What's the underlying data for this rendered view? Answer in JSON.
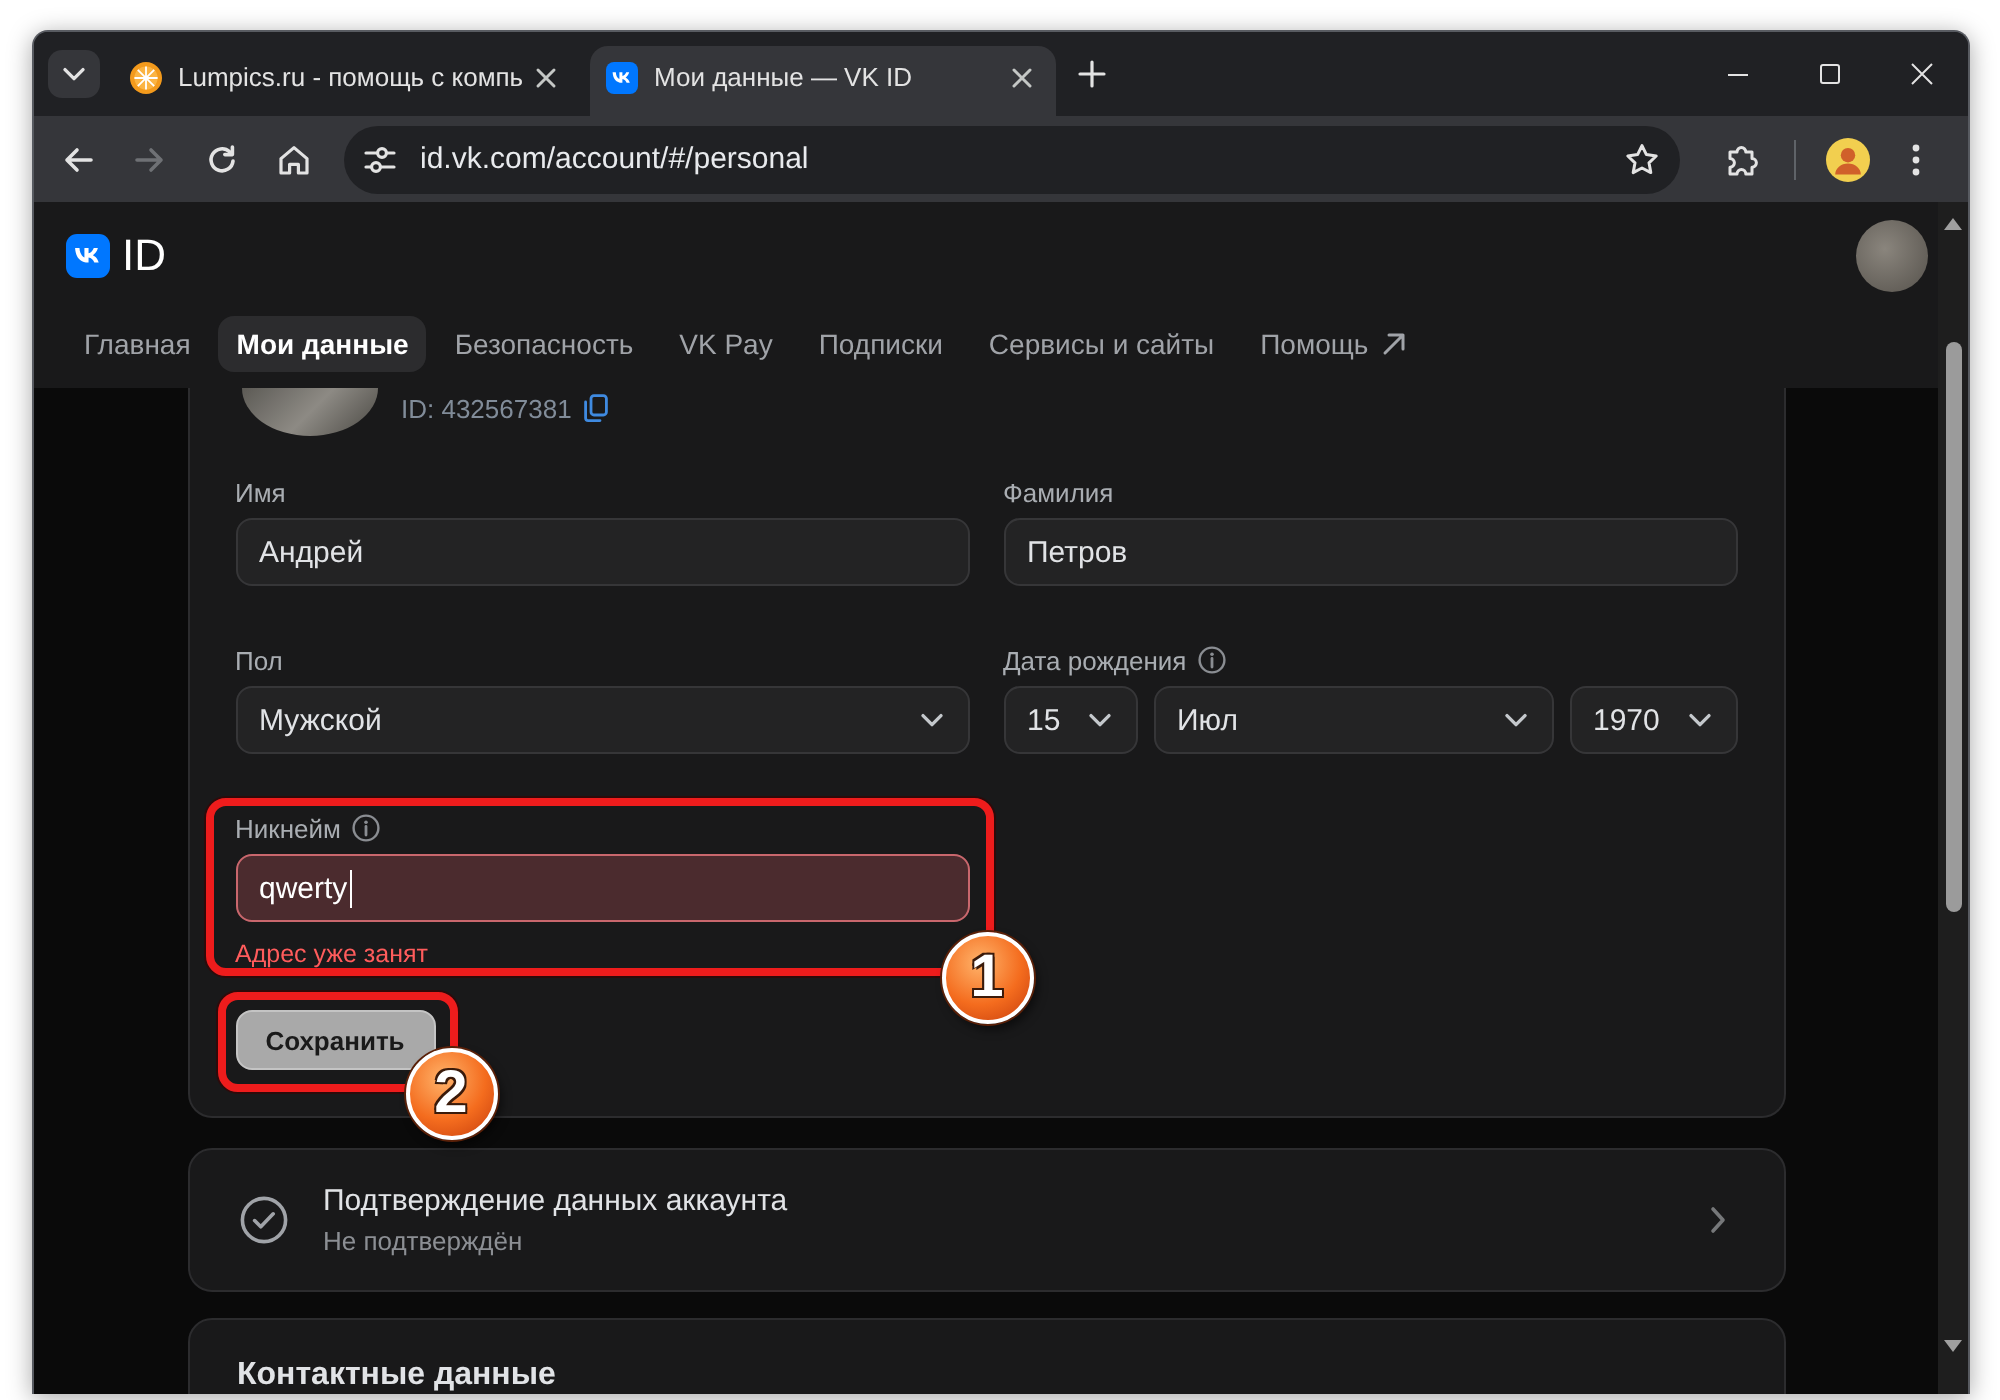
{
  "browser": {
    "tabs": [
      {
        "title": "Lumpics.ru - помощь с компь",
        "selected": false
      },
      {
        "title": "Мои данные — VK ID",
        "selected": true
      }
    ],
    "back": {
      "disabled": false
    },
    "forward": {
      "disabled": true
    },
    "address": "id.vk.com/account/#/personal"
  },
  "header": {
    "logo_text": "ID",
    "nav": [
      {
        "label": "Главная",
        "selected": false,
        "external": false
      },
      {
        "label": "Мои данные",
        "selected": true,
        "external": false
      },
      {
        "label": "Безопасность",
        "selected": false,
        "external": false
      },
      {
        "label": "VK Pay",
        "selected": false,
        "external": false
      },
      {
        "label": "Подписки",
        "selected": false,
        "external": false
      },
      {
        "label": "Сервисы и сайты",
        "selected": false,
        "external": false
      },
      {
        "label": "Помощь",
        "selected": false,
        "external": true
      }
    ]
  },
  "profile": {
    "id_text": "ID: 432567381",
    "fields": [
      {
        "kind": "text",
        "label": "Имя",
        "info": false,
        "value": "Андрей",
        "focused": false
      },
      {
        "kind": "text",
        "label": "Фамилия",
        "info": false,
        "value": "Петров",
        "focused": false
      },
      {
        "kind": "select",
        "label": "Пол",
        "info": false,
        "value": "Мужской"
      },
      {
        "kind": "date",
        "label": "Дата рождения",
        "info": true,
        "parts": [
          "15",
          "Июл",
          "1970"
        ]
      },
      {
        "kind": "text",
        "label": "Никнейм",
        "info": true,
        "value": "qwerty",
        "focused": true,
        "error": "Адрес уже занят",
        "callout": "1"
      }
    ],
    "save_button": {
      "label": "Сохранить",
      "callout": "2"
    }
  },
  "verification": {
    "title": "Подтверждение данных аккаунта",
    "status": "Не подтверждён"
  },
  "contacts": {
    "title": "Контактные данные"
  }
}
